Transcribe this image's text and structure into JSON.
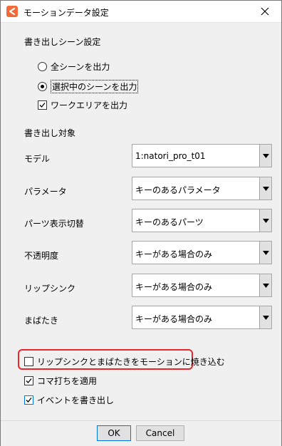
{
  "window": {
    "title": "モーションデータ設定"
  },
  "export_scene": {
    "heading": "書き出しシーン設定",
    "radio_all": "全シーンを出力",
    "radio_selected": "選択中のシーンを出力",
    "selected_option": "選択中のシーンを出力",
    "checkbox_workarea": "ワークエリアを出力",
    "workarea_checked": true
  },
  "export_target": {
    "heading": "書き出し対象",
    "rows": [
      {
        "label": "モデル",
        "value": "1:natori_pro_t01"
      },
      {
        "label": "パラメータ",
        "value": "キーのあるパラメータ"
      },
      {
        "label": "パーツ表示切替",
        "value": "キーのあるパーツ"
      },
      {
        "label": "不透明度",
        "value": "キーがある場合のみ"
      },
      {
        "label": "リップシンク",
        "value": "キーがある場合のみ"
      },
      {
        "label": "まばたき",
        "value": "キーがある場合のみ"
      }
    ]
  },
  "options": {
    "bake_lipsync_blink": {
      "label": "リップシンクとまばたきをモーションに焼き込む",
      "checked": false
    },
    "apply_frame_step": {
      "label": "コマ打ちを適用",
      "checked": true
    },
    "export_events": {
      "label": "イベントを書き出し",
      "checked": true
    }
  },
  "buttons": {
    "ok": "OK",
    "cancel": "Cancel"
  },
  "colors": {
    "accent_checkbox": "#0078d7",
    "highlight": "#e8262c",
    "app_icon": "#f26b3a"
  },
  "icons": {
    "app": "cubism-app-icon",
    "close": "close-icon",
    "dropdown": "chevron-down-icon",
    "checkmark": "checkmark-icon"
  }
}
